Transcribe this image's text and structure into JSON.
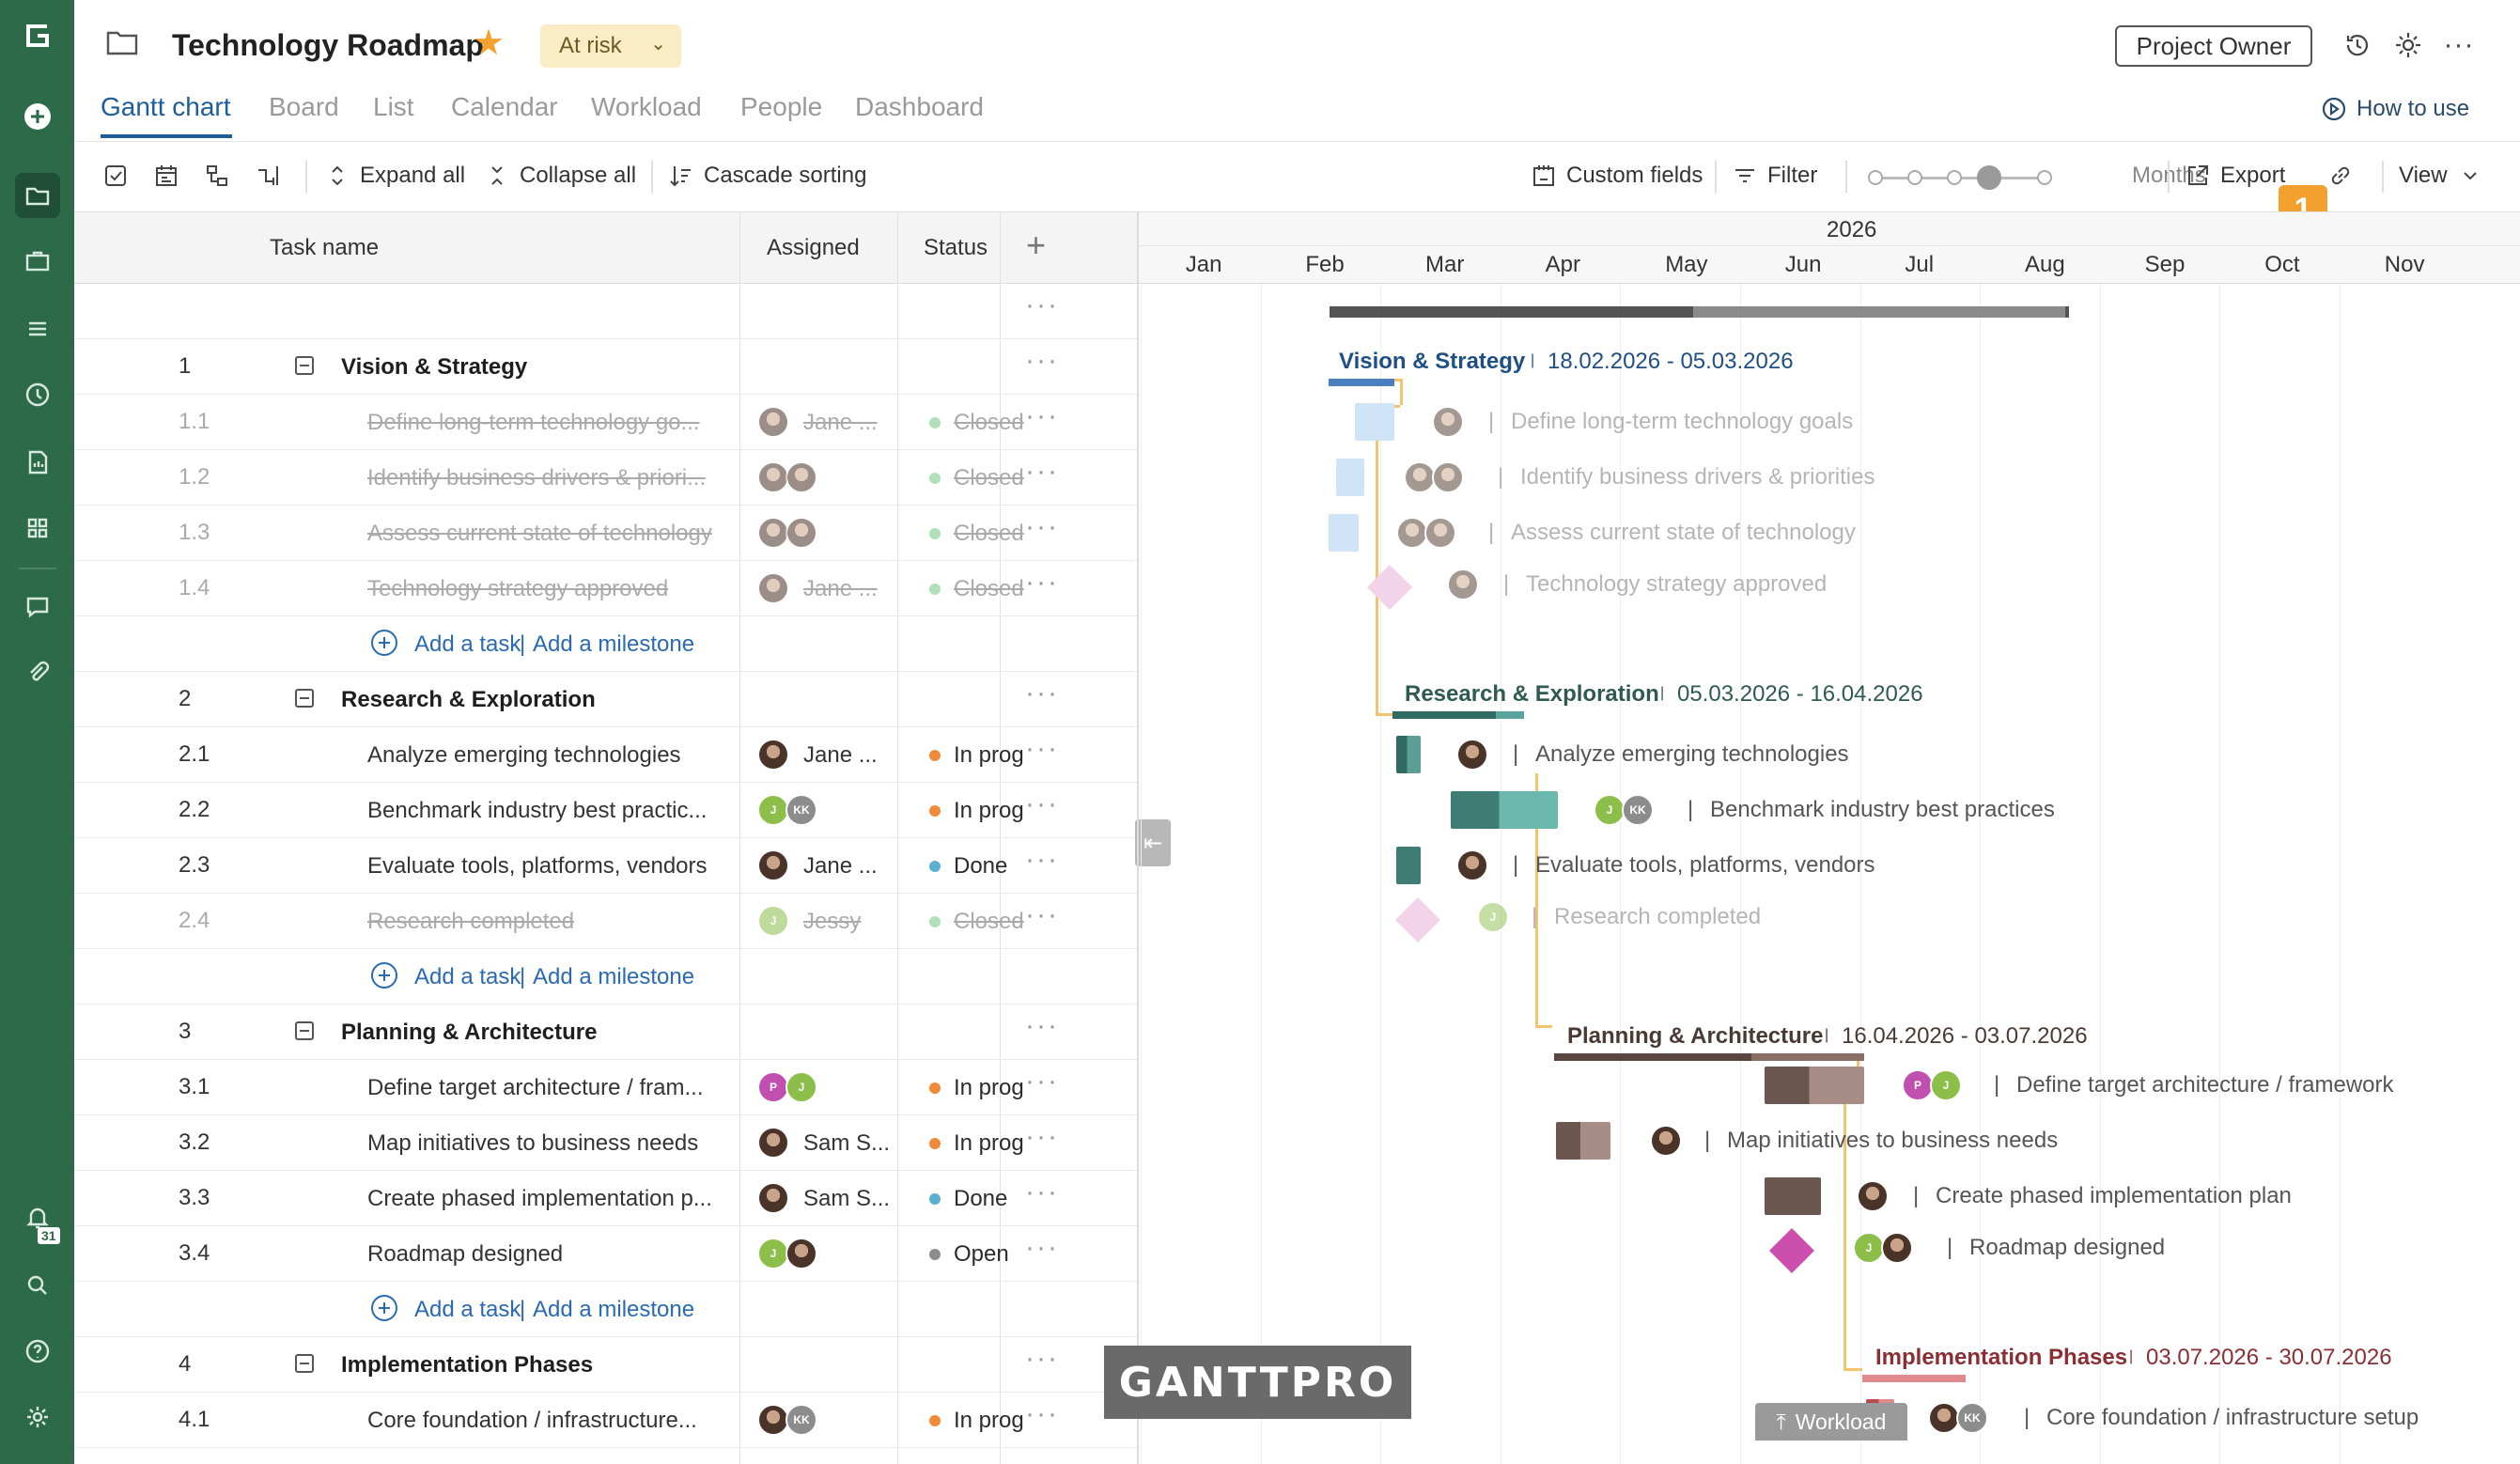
{
  "header": {
    "title": "Technology Roadmap",
    "status": "At risk",
    "owner_button": "Project Owner",
    "how_to_use": "How to use"
  },
  "tabs": [
    "Gantt chart",
    "Board",
    "List",
    "Calendar",
    "Workload",
    "People",
    "Dashboard"
  ],
  "toolbar": {
    "expand_all": "Expand all",
    "collapse_all": "Collapse all",
    "cascade_sorting": "Cascade sorting",
    "custom_fields": "Custom fields",
    "filter": "Filter",
    "zoom_label": "Months",
    "export": "Export",
    "view": "View",
    "badge": "1"
  },
  "grid": {
    "headers": {
      "task_name": "Task name",
      "assigned": "Assigned",
      "status": "Status"
    },
    "add_task": "Add a task",
    "add_milestone": "Add a milestone",
    "add_separator": "|"
  },
  "rows": [
    {
      "type": "group",
      "num": "1",
      "name": "Vision & Strategy"
    },
    {
      "type": "task",
      "num": "1.1",
      "name": "Define long-term technology go...",
      "assignee": "Jane ...",
      "avatars": [
        "photo"
      ],
      "status": "Closed",
      "done": true
    },
    {
      "type": "task",
      "num": "1.2",
      "name": "Identify business drivers & priori...",
      "assignee": "",
      "avatars": [
        "photo",
        "photo"
      ],
      "status": "Closed",
      "done": true
    },
    {
      "type": "task",
      "num": "1.3",
      "name": "Assess current state of technology",
      "assignee": "",
      "avatars": [
        "photo",
        "photo"
      ],
      "status": "Closed",
      "done": true
    },
    {
      "type": "task",
      "num": "1.4",
      "name": "Technology strategy approved",
      "assignee": "Jane ...",
      "avatars": [
        "photo"
      ],
      "status": "Closed",
      "done": true
    },
    {
      "type": "add"
    },
    {
      "type": "group",
      "num": "2",
      "name": "Research & Exploration"
    },
    {
      "type": "task",
      "num": "2.1",
      "name": "Analyze emerging technologies",
      "assignee": "Jane ...",
      "avatars": [
        "photo"
      ],
      "status": "In prog",
      "done": false
    },
    {
      "type": "task",
      "num": "2.2",
      "name": "Benchmark industry best practic...",
      "assignee": "",
      "avatars": [
        "J",
        "KK"
      ],
      "status": "In prog",
      "done": false
    },
    {
      "type": "task",
      "num": "2.3",
      "name": "Evaluate tools, platforms, vendors",
      "assignee": "Jane ...",
      "avatars": [
        "photo"
      ],
      "status": "Done",
      "done": false
    },
    {
      "type": "task",
      "num": "2.4",
      "name": "Research completed",
      "assignee": "Jessy",
      "avatars": [
        "J"
      ],
      "status": "Closed",
      "done": true
    },
    {
      "type": "add"
    },
    {
      "type": "group",
      "num": "3",
      "name": "Planning & Architecture"
    },
    {
      "type": "task",
      "num": "3.1",
      "name": "Define target architecture / fram...",
      "assignee": "",
      "avatars": [
        "P",
        "J"
      ],
      "status": "In prog",
      "done": false
    },
    {
      "type": "task",
      "num": "3.2",
      "name": "Map initiatives to business needs",
      "assignee": "Sam S...",
      "avatars": [
        "photo"
      ],
      "status": "In prog",
      "done": false
    },
    {
      "type": "task",
      "num": "3.3",
      "name": "Create phased implementation p...",
      "assignee": "Sam S...",
      "avatars": [
        "photo"
      ],
      "status": "Done",
      "done": false
    },
    {
      "type": "task",
      "num": "3.4",
      "name": "Roadmap designed",
      "assignee": "",
      "avatars": [
        "J",
        "photo"
      ],
      "status": "Open",
      "done": false
    },
    {
      "type": "add"
    },
    {
      "type": "group",
      "num": "4",
      "name": "Implementation Phases"
    },
    {
      "type": "task",
      "num": "4.1",
      "name": "Core foundation / infrastructure...",
      "assignee": "",
      "avatars": [
        "photo",
        "KK"
      ],
      "status": "In prog",
      "done": false
    }
  ],
  "status_colors": {
    "Closed": "#7cc98a",
    "In prog": "#f08a3a",
    "Done": "#5ab0cf",
    "Open": "#8c8c8c"
  },
  "timeline": {
    "year": "2026",
    "months": [
      "Jan",
      "Feb",
      "Mar",
      "Apr",
      "May",
      "Jun",
      "Jul",
      "Aug",
      "Sep",
      "Oct",
      "Nov"
    ],
    "groups": [
      {
        "title": "Vision & Strategy",
        "dates": "18.02.2026 - 05.03.2026",
        "color": "#1e4f85",
        "bar": "#4a7fc0"
      },
      {
        "title": "Research & Exploration",
        "dates": "05.03.2026 - 16.04.2026",
        "color": "#2f5a52",
        "bar": "#5aa39a"
      },
      {
        "title": "Planning & Architecture",
        "dates": "16.04.2026 - 03.07.2026",
        "color": "#4a3a34",
        "bar": "#8a6e66"
      },
      {
        "title": "Implementation Phases",
        "dates": "03.07.2026 - 30.07.2026",
        "color": "#8a2f33",
        "bar": "#e08a8e"
      }
    ],
    "tasks": [
      "Define long-term technology goals",
      "Identify business drivers & priorities",
      "Assess current state of technology",
      "Technology strategy approved",
      "Analyze emerging technologies",
      "Benchmark industry best practices",
      "Evaluate tools, platforms, vendors",
      "Research completed",
      "Define target architecture / framework",
      "Map initiatives to business needs",
      "Create phased implementation plan",
      "Roadmap designed",
      "Core foundation / infrastructure setup"
    ],
    "separator": "|"
  },
  "watermark": "GANTTPRO",
  "workload_tab": "Workload",
  "notifications_count": "31",
  "avatar_labels": {
    "J": "J",
    "KK": "KK",
    "P": "P"
  }
}
